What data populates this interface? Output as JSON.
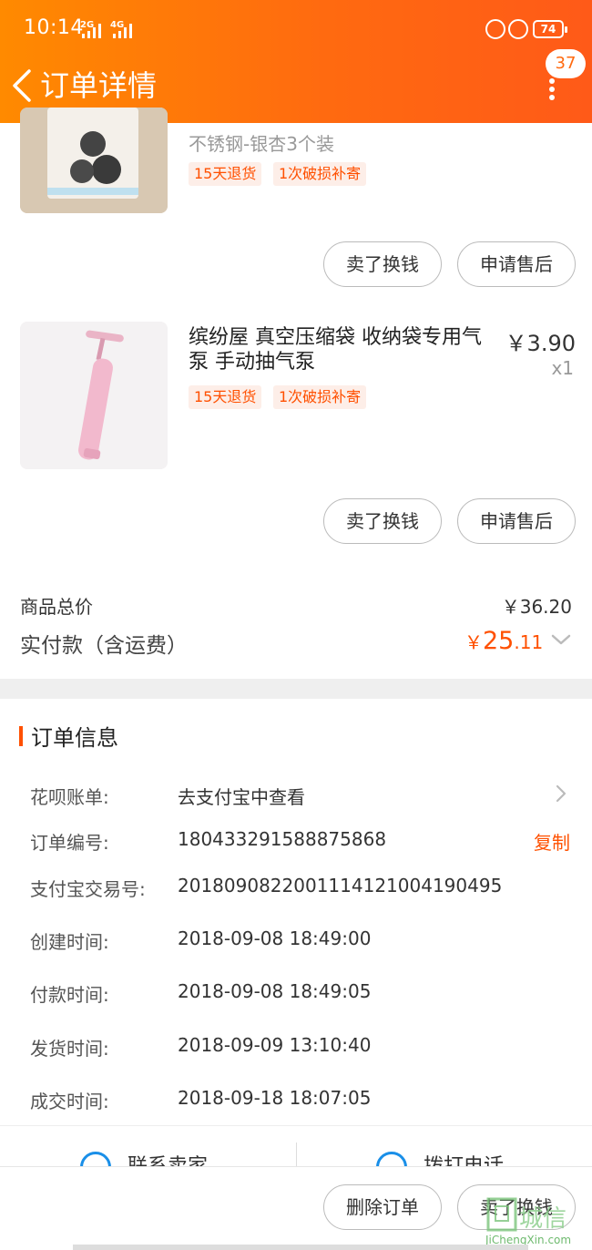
{
  "status_bar": {
    "time": "10:14",
    "network_1": "2G",
    "network_2": "4G",
    "battery": "74"
  },
  "header": {
    "title": "订单详情",
    "message_count": "37",
    "background_color": "#ff6a10"
  },
  "products": [
    {
      "subtitle": "不锈钢-银杏3个装",
      "tags": [
        "15天退货",
        "1次破损补寄"
      ],
      "buttons": [
        "卖了换钱",
        "申请售后"
      ]
    },
    {
      "title": "缤纷屋 真空压缩袋 收纳袋专用气泵 手动抽气泵",
      "price": "￥3.90",
      "quantity": "x1",
      "tags": [
        "15天退货",
        "1次破损补寄"
      ],
      "buttons": [
        "卖了换钱",
        "申请售后"
      ]
    }
  ],
  "totals": {
    "goods_label": "商品总价",
    "goods_value": "￥36.20",
    "paid_label": "实付款（含运费）",
    "paid_currency": "￥",
    "paid_integer": "25",
    "paid_decimal": ".11",
    "accent_color": "#ff5000"
  },
  "order_info": {
    "title": "订单信息",
    "rows": [
      {
        "label": "花呗账单:",
        "value": "去支付宝中查看"
      },
      {
        "label": "订单编号:",
        "value": "180433291588875868"
      },
      {
        "label": "支付宝交易号:",
        "value": "2018090822001114121004190495"
      },
      {
        "label": "创建时间:",
        "value": "2018-09-08 18:49:00"
      },
      {
        "label": "付款时间:",
        "value": "2018-09-08 18:49:05"
      },
      {
        "label": "发货时间:",
        "value": "2018-09-09 13:10:40"
      },
      {
        "label": "成交时间:",
        "value": "2018-09-18 18:07:05"
      }
    ],
    "copy_label": "复制"
  },
  "contact": {
    "seller_label": "联系卖家",
    "phone_label": "拨打电话"
  },
  "bottom_actions": {
    "delete_label": "删除订单",
    "sell_label": "卖了换钱"
  },
  "watermark": {
    "text": "城信",
    "url": "JiChengXin.com"
  }
}
